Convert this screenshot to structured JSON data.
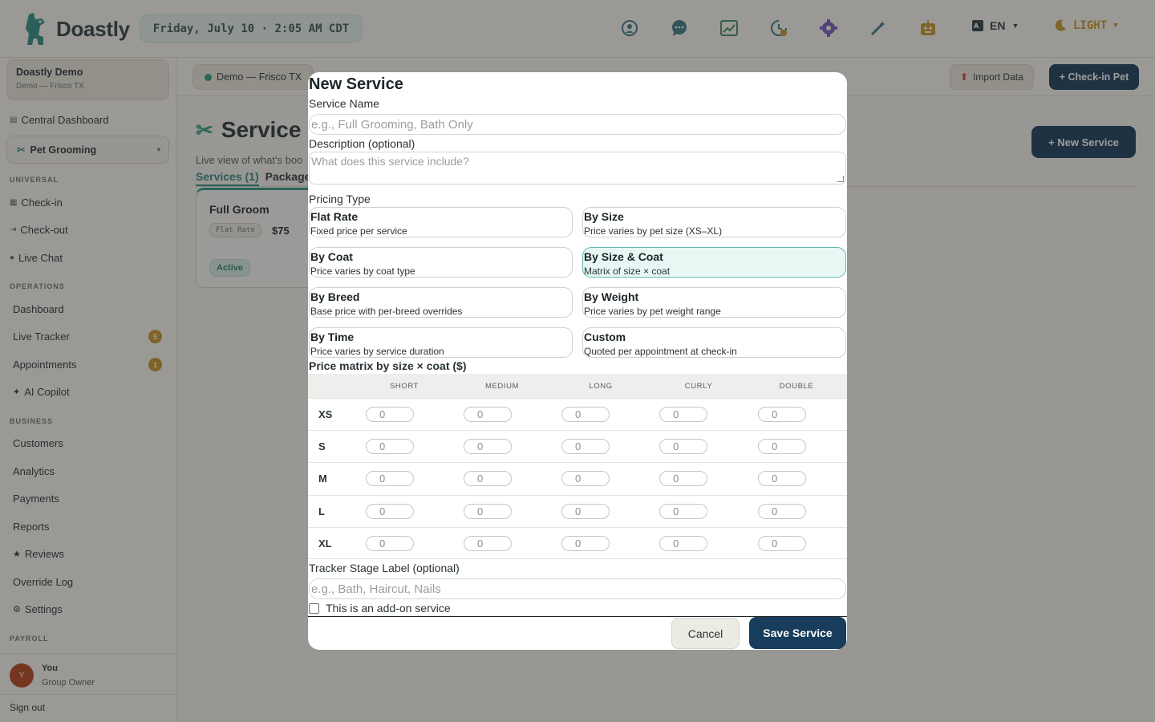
{
  "app": {
    "name": "Doastly"
  },
  "header": {
    "datetime": "Friday, July 10 · 2:05 AM CDT",
    "icons": [
      {
        "name": "support-agent-icon",
        "color": "#3e7a86"
      },
      {
        "name": "chat-bubble-icon",
        "color": "#3e7a86"
      },
      {
        "name": "trend-chart-icon",
        "color": "#3f8f5a"
      },
      {
        "name": "clock-history-icon",
        "color": "#3e7a86"
      },
      {
        "name": "settings-gear-icon",
        "color": "#7a5bbd"
      },
      {
        "name": "magic-wand-icon",
        "color": "#3e7a86"
      },
      {
        "name": "robot-icon",
        "color": "#c89a2a"
      }
    ],
    "language": "EN",
    "theme": "LIGHT"
  },
  "sidebar": {
    "org_name": "Doastly Demo",
    "org_location": "Demo — Frisco TX",
    "central_dashboard": "Central Dashboard",
    "workspace": "Pet Grooming",
    "sections": {
      "universal": "UNIVERSAL",
      "operations": "OPERATIONS",
      "business": "BUSINESS",
      "payroll": "PAYROLL"
    },
    "universal_items": [
      "Check-in",
      "Check-out",
      "Live Chat"
    ],
    "operations_items": [
      "Dashboard",
      "Live Tracker",
      "Appointments",
      "AI Copilot"
    ],
    "live_tracker_badge": "5",
    "appointments_badge": "1",
    "business_items": [
      "Customers",
      "Analytics",
      "Payments",
      "Reports",
      "Reviews",
      "Override Log",
      "Settings"
    ],
    "user": {
      "initial": "Y",
      "name": "You",
      "role": "Group Owner"
    },
    "sign_out": "Sign out"
  },
  "main": {
    "location_pill": "Demo — Frisco TX",
    "import_label": "Import Data",
    "checkin_label": "+ Check-in Pet",
    "page_title": "Service",
    "page_subtitle": "Live view of what's boo",
    "tabs": [
      "Services (1)",
      "Packages"
    ],
    "new_service_label": "+ New Service",
    "service_card": {
      "name": "Full Groom",
      "pricing_tag": "Flat Rate",
      "price": "$75",
      "status": "Active"
    }
  },
  "modal": {
    "title": "New Service",
    "service_name_label": "Service Name",
    "service_name_placeholder": "e.g., Full Grooming, Bath Only",
    "description_label": "Description (optional)",
    "description_placeholder": "What does this service include?",
    "pricing_type_label": "Pricing Type",
    "pricing_options": [
      {
        "title": "Flat Rate",
        "desc": "Fixed price per service",
        "selected": false
      },
      {
        "title": "By Size",
        "desc": "Price varies by pet size (XS–XL)",
        "selected": false
      },
      {
        "title": "By Coat",
        "desc": "Price varies by coat type",
        "selected": false
      },
      {
        "title": "By Size & Coat",
        "desc": "Matrix of size × coat",
        "selected": true
      },
      {
        "title": "By Breed",
        "desc": "Base price with per-breed overrides",
        "selected": false
      },
      {
        "title": "By Weight",
        "desc": "Price varies by pet weight range",
        "selected": false
      },
      {
        "title": "By Time",
        "desc": "Price varies by service duration",
        "selected": false
      },
      {
        "title": "Custom",
        "desc": "Quoted per appointment at check-in",
        "selected": false
      }
    ],
    "matrix_label": "Price matrix by size × coat ($)",
    "matrix_columns": [
      "SHORT",
      "MEDIUM",
      "LONG",
      "CURLY",
      "DOUBLE"
    ],
    "matrix_rows": [
      "XS",
      "S",
      "M",
      "L",
      "XL"
    ],
    "matrix_values": [
      [
        "0",
        "0",
        "0",
        "0",
        "0"
      ],
      [
        "0",
        "0",
        "0",
        "0",
        "0"
      ],
      [
        "0",
        "0",
        "0",
        "0",
        "0"
      ],
      [
        "0",
        "0",
        "0",
        "0",
        "0"
      ],
      [
        "0",
        "0",
        "0",
        "0",
        "0"
      ]
    ],
    "tracker_label": "Tracker Stage Label (optional)",
    "tracker_placeholder": "e.g., Bath, Haircut, Nails",
    "addon_label": "This is an add-on service",
    "addon_checked": false,
    "cancel_label": "Cancel",
    "save_label": "Save Service"
  },
  "colors": {
    "primary": "#173c5c",
    "accent": "#2f9a86",
    "selected_option_bg": "#e9f7f4",
    "badge": "#c9962a"
  }
}
